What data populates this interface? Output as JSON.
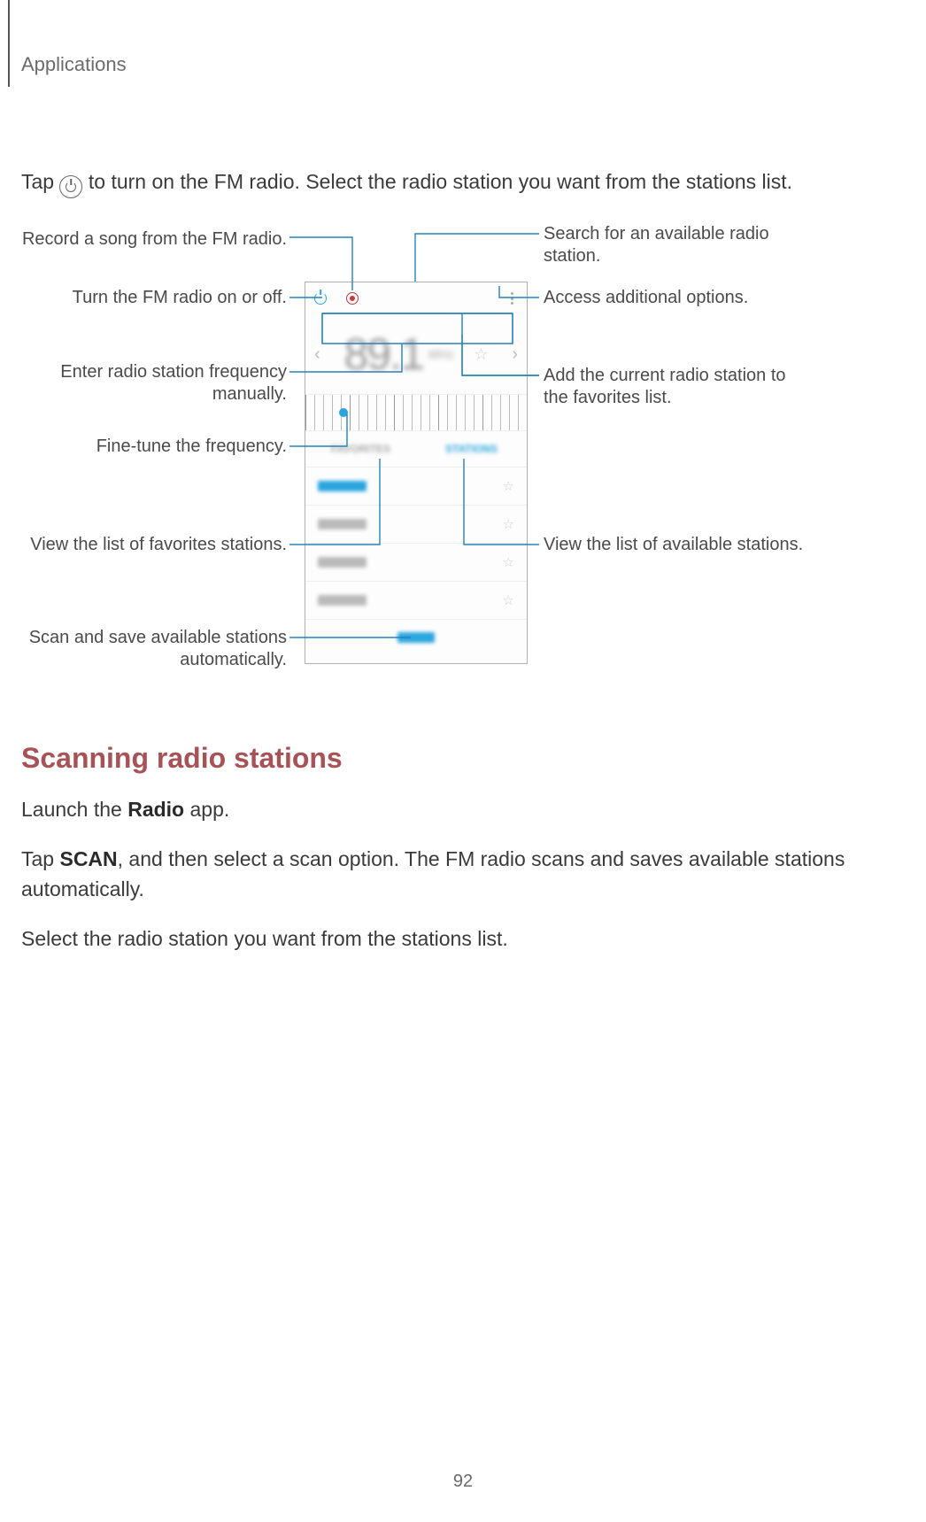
{
  "header": {
    "title": "Applications"
  },
  "intro": {
    "pre": "Tap ",
    "post": " to turn on the FM radio. Select the radio station you want from the stations list."
  },
  "callouts": {
    "left": {
      "record": "Record a song from the FM radio.",
      "power": "Turn the FM radio on or off.",
      "manual": "Enter radio station frequency manually.",
      "finetune": "Fine-tune the frequency.",
      "favlist": "View the list of favorites stations.",
      "scan": "Scan and save available stations automatically."
    },
    "right": {
      "search": "Search for an available radio station.",
      "more": "Access additional options.",
      "addfav": "Add the current radio station to the favorites list.",
      "available": "View the list of available stations."
    }
  },
  "section": {
    "heading": "Scanning radio stations",
    "p1_a": "Launch the ",
    "p1_b": "Radio",
    "p1_c": " app.",
    "p2_a": "Tap ",
    "p2_b": "SCAN",
    "p2_c": ", and then select a scan option. The FM radio scans and saves available stations automatically.",
    "p3": "Select the radio station you want from the stations list."
  },
  "page_number": "92"
}
